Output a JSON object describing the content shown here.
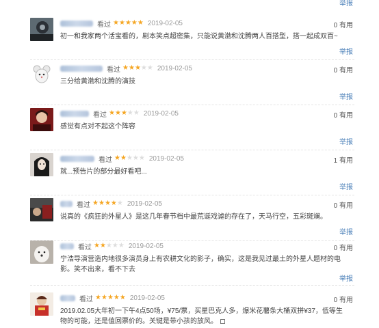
{
  "report_top_label": "举报",
  "reviews": [
    {
      "action": "看过",
      "stars": 5,
      "date": "2019-02-05",
      "useful": "0 有用",
      "comment": "初一和我家两个活宝看的，剧本笑点超密集，只能说黄渤和沈腾两人百搭型，搭一起成双百~",
      "report": "举报"
    },
    {
      "action": "看过",
      "stars": 3,
      "date": "2019-02-05",
      "useful": "0 有用",
      "comment": "三分给黄渤和沈腾的演技",
      "report": "举报"
    },
    {
      "action": "看过",
      "stars": 3,
      "date": "2019-02-05",
      "useful": "0 有用",
      "comment": "感觉有点对不起这个阵容",
      "report": "举报"
    },
    {
      "action": "看过",
      "stars": 2,
      "date": "2019-02-05",
      "useful": "1 有用",
      "comment": "就...预告片的部分最好看吧...",
      "report": "举报"
    },
    {
      "action": "看过",
      "stars": 4,
      "date": "2019-02-05",
      "useful": "0 有用",
      "comment": "说真的《疯狂的外星人》是这几年春节档中最荒诞戏谑的存在了，天马行空，五彩斑斓。",
      "report": "举报"
    },
    {
      "action": "看过",
      "stars": 2,
      "date": "2019-02-05",
      "useful": "0 有用",
      "comment": "宁浩导演营造内地很多演员身上有农耕文化的影子，确实，这是我见过最土的外星人题材的电影。笑不出来，看不下去",
      "report": "举报"
    },
    {
      "action": "看过",
      "stars": 5,
      "date": "2019-02-05",
      "useful": "0 有用",
      "comment": "2019.02.05大年初一下午4点50场，¥75/票，买星巴克人多，爆米花薯条大桶双拼¥37，低等生物的可能，还是值回票价的。关键是带小孩的放风。",
      "report": ""
    }
  ],
  "colors": {
    "star_on": "#f5a623",
    "star_off": "#dddddd",
    "link": "#4a7fb8"
  }
}
